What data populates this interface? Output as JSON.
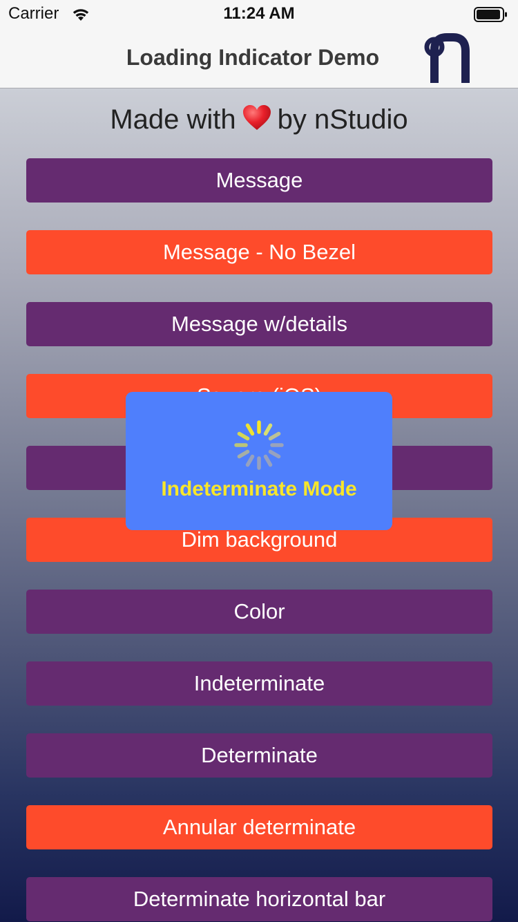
{
  "status_bar": {
    "carrier": "Carrier",
    "time": "11:24 AM",
    "wifi_icon": "wifi-icon",
    "battery_icon": "battery-icon"
  },
  "nav": {
    "title": "Loading Indicator Demo",
    "logo_icon": "nstudio-logo-icon"
  },
  "tagline": {
    "before": "Made with",
    "heart_icon": "heart-icon",
    "after": "by nStudio"
  },
  "buttons": [
    {
      "label": "Message",
      "color": "purple"
    },
    {
      "label": "Message - No Bezel",
      "color": "orange"
    },
    {
      "label": "Message w/details",
      "color": "purple"
    },
    {
      "label": "Square (iOS)",
      "color": "orange"
    },
    {
      "label": "",
      "color": "purple"
    },
    {
      "label": "Dim background",
      "color": "orange"
    },
    {
      "label": "Color",
      "color": "purple"
    },
    {
      "label": "Indeterminate",
      "color": "purple"
    },
    {
      "label": "Determinate",
      "color": "purple"
    },
    {
      "label": "Annular determinate",
      "color": "orange"
    },
    {
      "label": "Determinate horizontal bar",
      "color": "purple"
    }
  ],
  "hud": {
    "message": "Indeterminate Mode",
    "spinner_icon": "activity-spinner-icon"
  },
  "colors": {
    "purple": "#652b70",
    "orange": "#fe4b2b",
    "hud_background": "#4f7ffc",
    "hud_text": "#f8e62a",
    "logo": "#1e2150"
  }
}
